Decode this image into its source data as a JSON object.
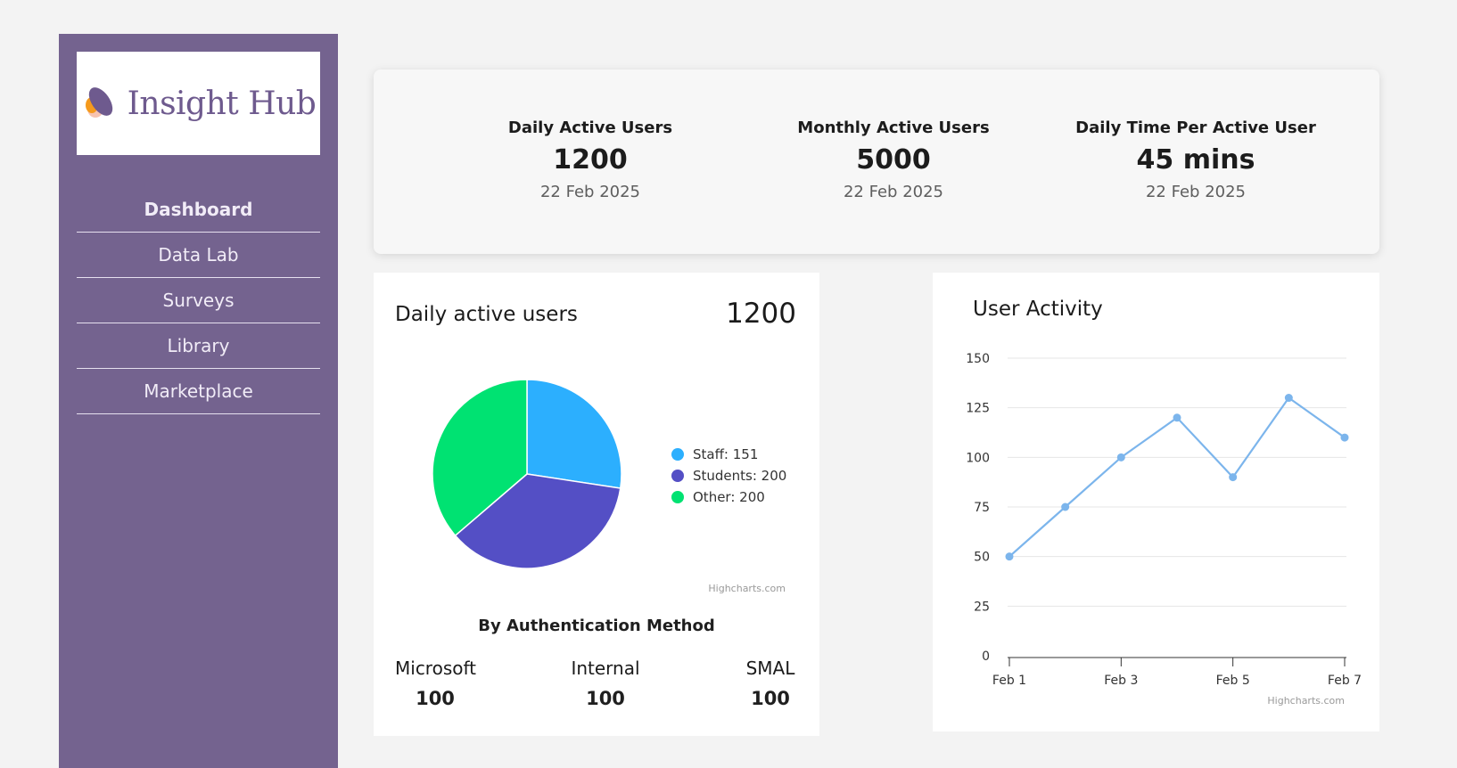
{
  "sidebar": {
    "logo_text": "Insight Hub",
    "items": [
      {
        "label": "Dashboard",
        "active": true
      },
      {
        "label": "Data Lab"
      },
      {
        "label": "Surveys"
      },
      {
        "label": "Library"
      },
      {
        "label": "Marketplace"
      }
    ]
  },
  "stats": [
    {
      "title": "Daily Active Users",
      "value": "1200",
      "date": "22 Feb 2025"
    },
    {
      "title": "Monthly Active Users",
      "value": "5000",
      "date": "22 Feb 2025"
    },
    {
      "title": "Daily Time Per Active User",
      "value": "45 mins",
      "date": "22 Feb 2025"
    }
  ],
  "pie_panel": {
    "title": "Daily active users",
    "total": "1200",
    "credit": "Highcharts.com",
    "auth_heading": "By Authentication Method",
    "auth": [
      {
        "label": "Microsoft",
        "value": "100"
      },
      {
        "label": "Internal",
        "value": "100"
      },
      {
        "label": "SMAL",
        "value": "100"
      }
    ]
  },
  "line_panel": {
    "title": "User Activity",
    "credit": "Highcharts.com"
  },
  "chart_data": [
    {
      "type": "pie",
      "title": "Daily active users",
      "slices": [
        {
          "name": "Staff",
          "value": 151,
          "label": "Staff: 151",
          "color": "#2caffe"
        },
        {
          "name": "Students",
          "value": 200,
          "label": "Students: 200",
          "color": "#544fc5"
        },
        {
          "name": "Other",
          "value": 200,
          "label": "Other: 200",
          "color": "#00e272"
        }
      ],
      "legend_position": "right"
    },
    {
      "type": "line",
      "title": "User Activity",
      "x": [
        "Feb 1",
        "Feb 2",
        "Feb 3",
        "Feb 4",
        "Feb 5",
        "Feb 6",
        "Feb 7"
      ],
      "x_tick_labels": [
        "Feb 1",
        "Feb 3",
        "Feb 5",
        "Feb 7"
      ],
      "series": [
        {
          "values": [
            50,
            75,
            100,
            120,
            90,
            130,
            110
          ],
          "color": "#7cb5ec"
        }
      ],
      "ylim": [
        0,
        150
      ],
      "y_ticks": [
        0,
        25,
        50,
        75,
        100,
        125,
        150
      ],
      "grid": true
    }
  ]
}
